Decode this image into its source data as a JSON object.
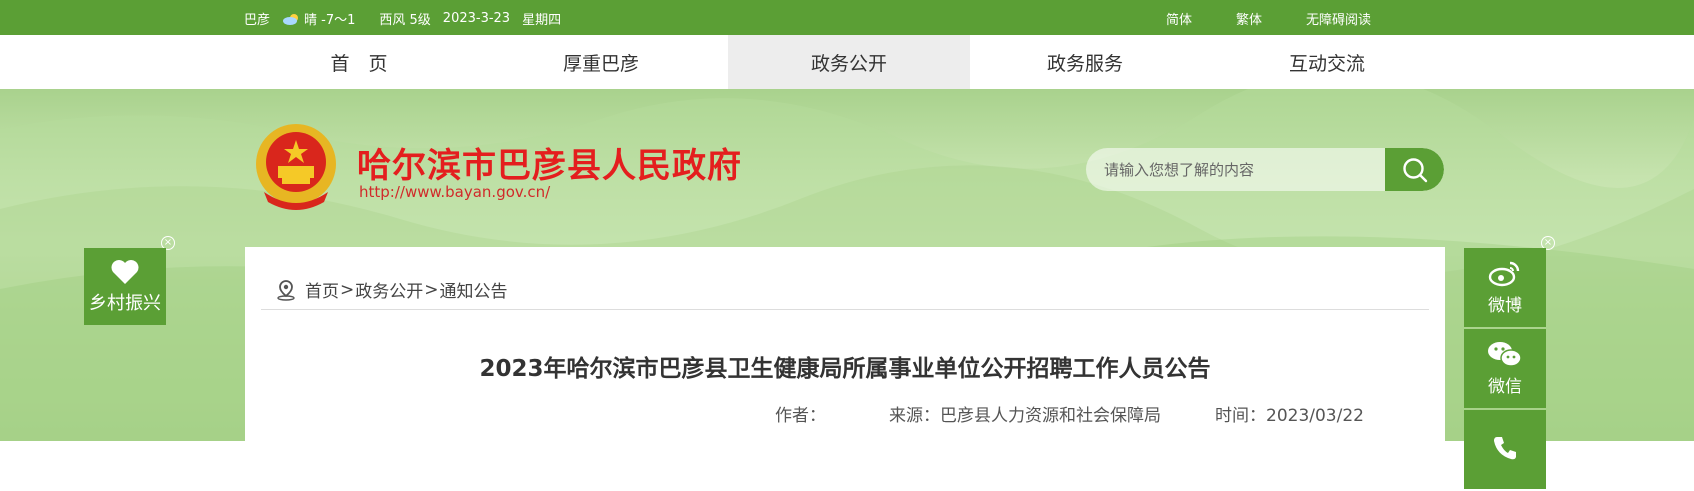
{
  "topbar": {
    "location": "巴彦",
    "weather": "晴 -7～1",
    "wind": "西风 5级",
    "date": "2023-3-23",
    "weekday": "星期四",
    "links": [
      "简体",
      "繁体",
      "无障碍阅读"
    ]
  },
  "nav": {
    "items": [
      "首　页",
      "厚重巴彦",
      "政务公开",
      "政务服务",
      "互动交流"
    ],
    "active_index": 2
  },
  "header": {
    "site_title": "哈尔滨市巴彦县人民政府",
    "site_url": "http://www.bayan.gov.cn/",
    "search_placeholder": "请输入您想了解的内容"
  },
  "float_left": {
    "label": "乡村振兴",
    "icon": "heart-icon"
  },
  "float_right": {
    "items": [
      {
        "label": "微博",
        "icon": "weibo-icon"
      },
      {
        "label": "微信",
        "icon": "wechat-icon"
      },
      {
        "label": "",
        "icon": "phone-icon"
      }
    ]
  },
  "breadcrumb": [
    "首页",
    "政务公开",
    "通知公告"
  ],
  "article": {
    "title": "2023年哈尔滨市巴彦县卫生健康局所属事业单位公开招聘工作人员公告",
    "author_label": "作者：",
    "source": "来源：巴彦县人力资源和社会保障局",
    "time": "时间：2023/03/22"
  },
  "colors": {
    "brand_green": "#5b9f35",
    "title_red": "#e41e1e"
  }
}
